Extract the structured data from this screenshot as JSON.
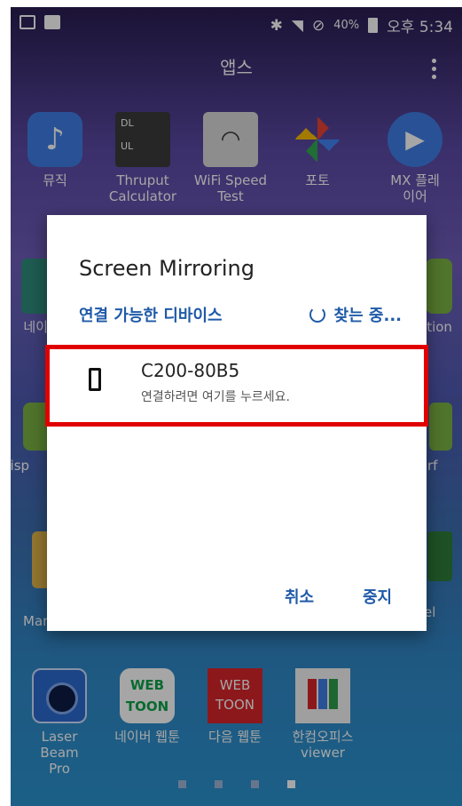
{
  "status_bar": {
    "battery": "40%",
    "time": "오후 5:34"
  },
  "app_bar": {
    "title": "앱스"
  },
  "apps": [
    {
      "label": "뮤직"
    },
    {
      "label": "Thruput Calculator"
    },
    {
      "label": "WiFi Speed Test"
    },
    {
      "label": "포토"
    },
    {
      "label": "MX 플레이어"
    },
    {
      "label": "네이"
    },
    {
      "label": "ation"
    },
    {
      "label": "Disp"
    },
    {
      "label": "rf"
    },
    {
      "label": "Manager"
    },
    {
      "label": "el"
    },
    {
      "label": "Laser Beam Pro"
    },
    {
      "label": "네이버 웹툰"
    },
    {
      "label": "다음 웹툰"
    },
    {
      "label": "한컴오피스 viewer"
    }
  ],
  "dialog": {
    "title": "Screen Mirroring",
    "subtitle": "연결 가능한 디바이스",
    "search_status": "찾는 중...",
    "device": {
      "name": "C200-80B5",
      "hint": "연결하려면 여기를 누르세요."
    },
    "cancel_label": "취소",
    "stop_label": "중지"
  },
  "page_indicator": {
    "pages": 4,
    "current": 4
  }
}
